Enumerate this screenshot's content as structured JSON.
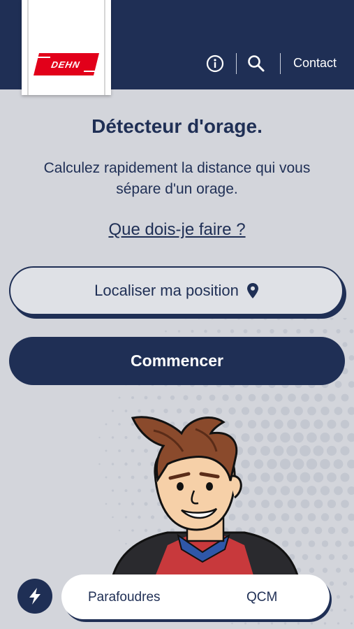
{
  "header": {
    "logo_text": "DEHN",
    "info_icon": "info-icon",
    "search_icon": "search-icon",
    "contact_label": "Contact"
  },
  "main": {
    "title": "Détecteur d'orage.",
    "subtitle_line1": "Calculez rapidement la distance qui vous",
    "subtitle_line2": "sépare d'un orage.",
    "help_link": "Que dois-je faire ?",
    "locate_button": "Localiser ma position",
    "locate_icon": "map-pin-icon",
    "start_button": "Commencer"
  },
  "bottom_nav": {
    "bolt_icon": "lightning-bolt-icon",
    "tab_parafoudres": "Parafoudres",
    "tab_qcm": "QCM"
  },
  "colors": {
    "navy": "#1f2f55",
    "background": "#d3d5db",
    "brand_red": "#e2001a",
    "white": "#ffffff"
  }
}
